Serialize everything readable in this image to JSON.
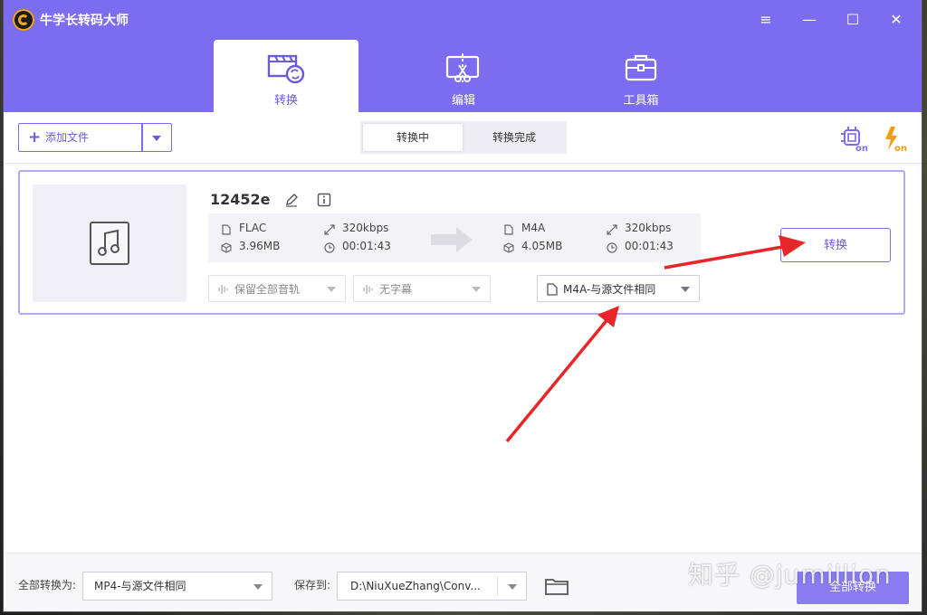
{
  "app": {
    "title": "牛学长转码大师"
  },
  "window_controls": {
    "menu": "≡",
    "minimize": "—",
    "maximize": "☐",
    "close": "✕"
  },
  "nav": {
    "tabs": [
      {
        "label": "转换",
        "icon": "film-convert-icon",
        "active": true
      },
      {
        "label": "编辑",
        "icon": "edit-cut-icon",
        "active": false
      },
      {
        "label": "工具箱",
        "icon": "toolbox-icon",
        "active": false
      }
    ]
  },
  "toolbar": {
    "add_file_label": "添加文件",
    "segments": [
      {
        "label": "转换中",
        "active": true
      },
      {
        "label": "转换完成",
        "active": false
      }
    ],
    "icons": [
      "gpu-on-icon",
      "speed-on-icon"
    ]
  },
  "task": {
    "file_name": "12452e",
    "source": {
      "format": "FLAC",
      "bitrate": "320kbps",
      "size": "3.96MB",
      "duration": "00:01:43"
    },
    "target": {
      "format": "M4A",
      "bitrate": "320kbps",
      "size": "4.05MB",
      "duration": "00:01:43"
    },
    "audio_track": "保留全部音轨",
    "subtitle": "无字幕",
    "output_format": "M4A-与源文件相同",
    "convert_label": "转换"
  },
  "footer": {
    "convert_all_to_label": "全部转换为:",
    "convert_all_to_value": "MP4-与源文件相同",
    "save_to_label": "保存到:",
    "save_to_value": "D:\\NiuXueZhang\\Conv...",
    "convert_all_button": "全部转换"
  },
  "watermark": "知乎 @jumillion",
  "colors": {
    "accent": "#7b6cf0",
    "annotation_arrow": "#e8262a"
  }
}
